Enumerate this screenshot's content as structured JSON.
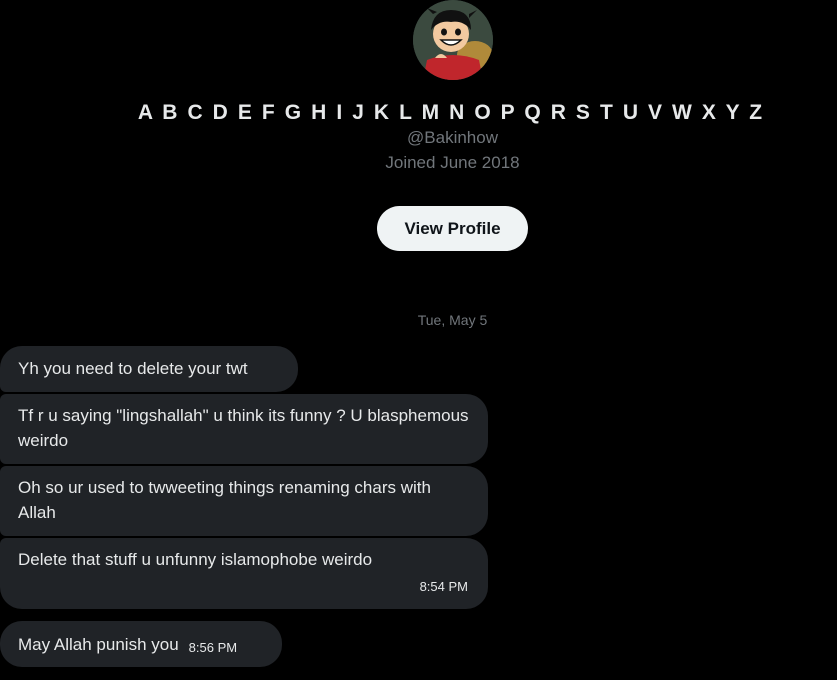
{
  "profile": {
    "display_name": "A B C D E F G H I J K L M N O P Q R S T U V W X Y Z",
    "handle": "@Bakinhow",
    "joined": "Joined June 2018",
    "view_profile_label": "View Profile",
    "avatar_icon": "cartoon-character-avatar"
  },
  "conversation": {
    "date_separator": "Tue, May 5",
    "messages": [
      {
        "text": "Yh you need to delete your twt",
        "time": ""
      },
      {
        "text": "Tf r u saying \"lingshallah\" u think its funny ? U blasphemous weirdo",
        "time": ""
      },
      {
        "text": "Oh so ur used to twweeting things renaming chars with Allah",
        "time": ""
      },
      {
        "text": "Delete that stuff u unfunny islamophobe weirdo",
        "time": "8:54 PM"
      },
      {
        "text": "May Allah punish you",
        "time": "8:56 PM"
      }
    ]
  },
  "colors": {
    "background": "#000000",
    "bubble": "#202327",
    "text": "#e7e9ea",
    "muted": "#71767b",
    "button_bg": "#eff3f4"
  }
}
